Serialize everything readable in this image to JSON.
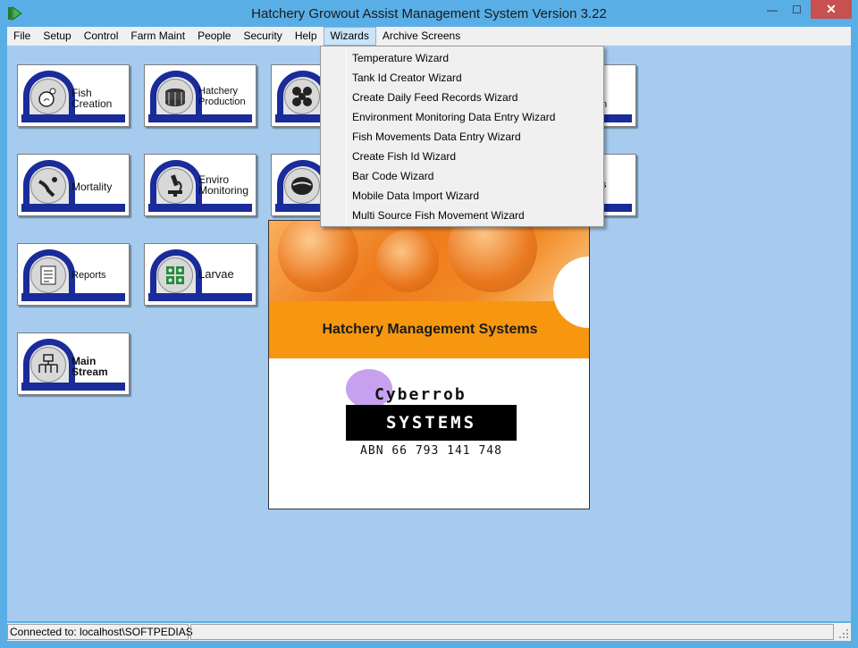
{
  "window": {
    "title": "Hatchery Growout Assist Management System Version 3.22",
    "close_glyph": "✕",
    "min_glyph": "—",
    "max_glyph": "☐"
  },
  "menu": [
    "File",
    "Setup",
    "Control",
    "Farm Maint",
    "People",
    "Security",
    "Help",
    "Wizards",
    "Archive Screens"
  ],
  "active_menu": "Wizards",
  "wizards_dropdown": [
    "Temperature Wizard",
    "Tank Id Creator Wizard",
    "Create Daily Feed Records Wizard",
    "Environment Monitoring Data Entry Wizard",
    "Fish Movements Data Entry Wizard",
    "Create Fish Id Wizard",
    "Bar Code Wizard",
    "Mobile Data Import Wizard",
    "Multi Source Fish Movement Wizard"
  ],
  "tiles": {
    "fish_creation": {
      "line1": "Fish",
      "line2": "Creation",
      "icon": "fish-egg-icon"
    },
    "hatchery_production": {
      "line1": "Hatchery",
      "line2": "Production",
      "icon": "tank-icon"
    },
    "tile3": {
      "line1": "",
      "line2": "",
      "icon": "cells-icon"
    },
    "tile4": {
      "line1": "",
      "line2": "",
      "icon": "fish-icon"
    },
    "mortality": {
      "line1": "Mortality",
      "line2": "",
      "icon": "dead-fish-icon"
    },
    "enviro_monitoring": {
      "line1": "Enviro",
      "line2": "Monitoring",
      "icon": "microscope-icon"
    },
    "reports": {
      "line1": "Reports",
      "line2": "",
      "icon": "report-icon"
    },
    "larvae": {
      "line1": "Larvae",
      "line2": "",
      "icon": "larvae-icon"
    },
    "main_stream": {
      "line1": "Main",
      "line2": "Stream",
      "icon": "hierarchy-icon"
    },
    "right1_suffix": "n",
    "right2_suffix": "s"
  },
  "splash": {
    "band_title": "Hatchery Management Systems",
    "company_name": "Cyberrob",
    "company_suffix": "SYSTEMS",
    "abn": "ABN 66 793 141 748"
  },
  "status": {
    "connection": "Connected to: localhost\\SOFTPEDIAS"
  },
  "colors": {
    "desktop": "#a6cbee",
    "tile_stripe": "#1a2b9a",
    "splash_orange": "#f6970f",
    "close_button": "#c75050"
  }
}
